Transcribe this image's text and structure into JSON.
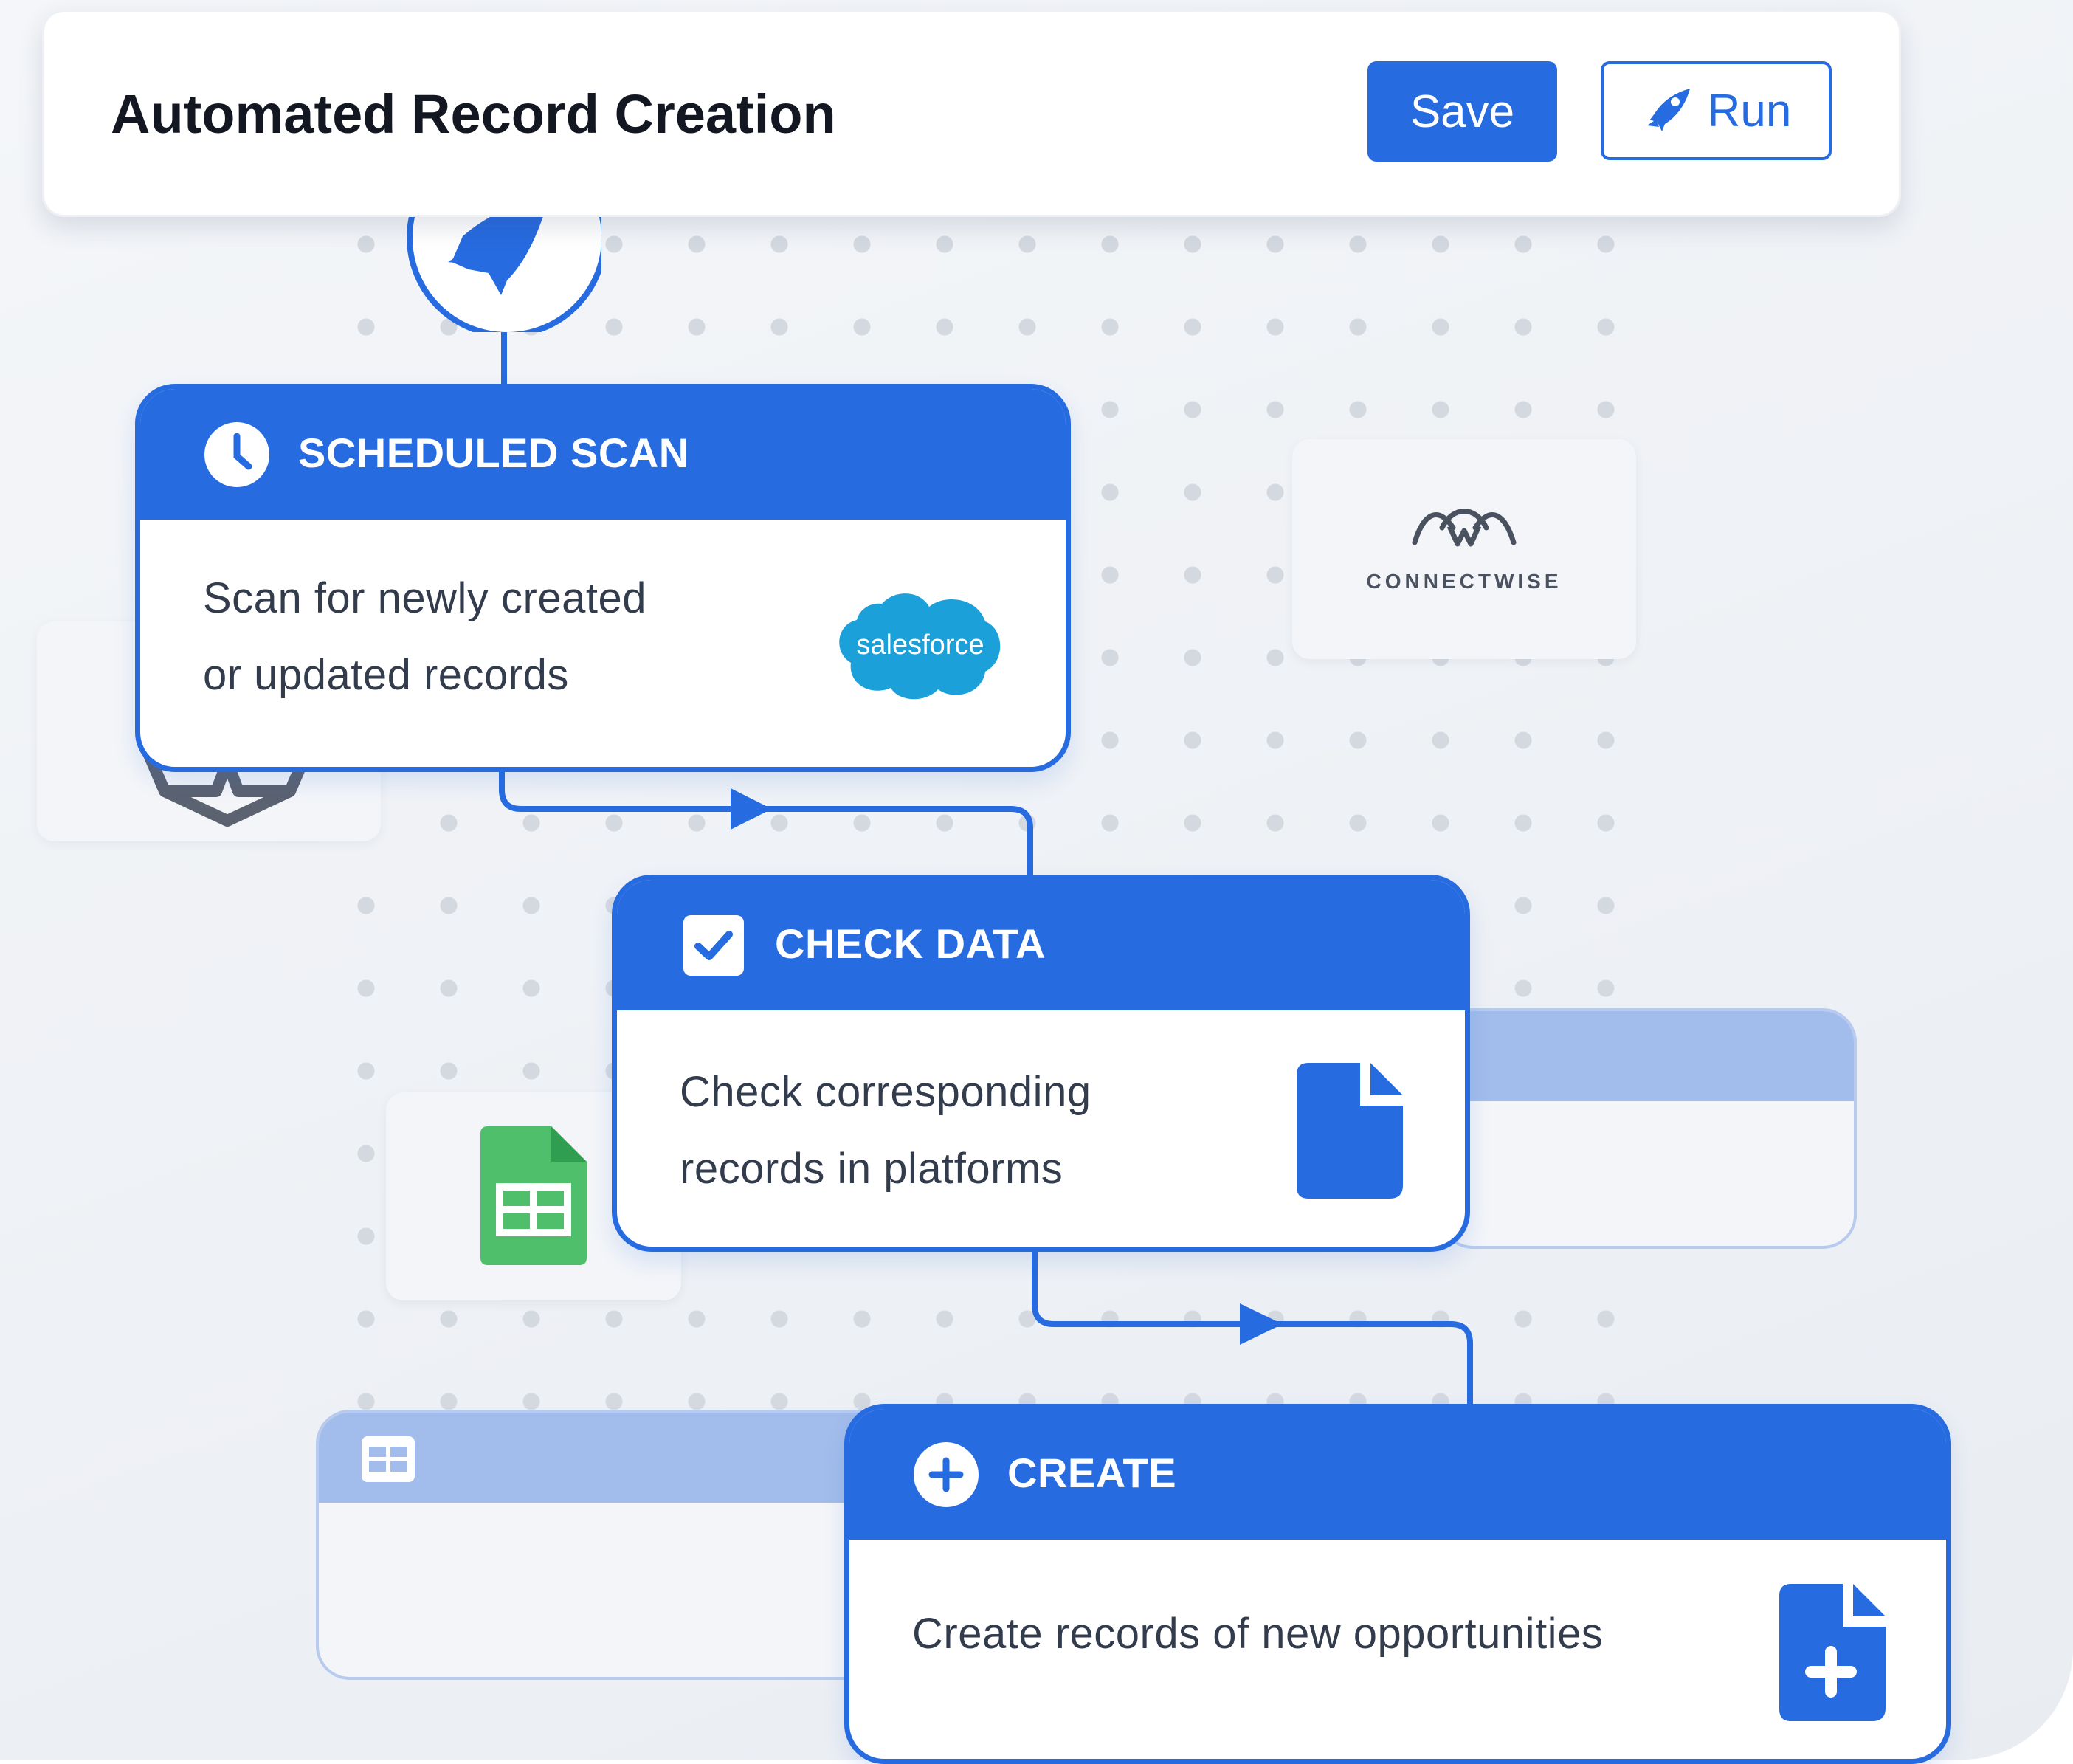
{
  "toolbar": {
    "title": "Automated Record Creation",
    "save_label": "Save",
    "run_label": "Run",
    "run_icon": "rocket-icon"
  },
  "trigger": {
    "icon": "rocket-icon"
  },
  "integrations": {
    "connectwise_label": "CONNECTWISE",
    "connectwise_icon": "connectwise-logo",
    "sheets_icon": "google-sheets-icon",
    "left_icon": "integration-logo"
  },
  "steps": {
    "scan": {
      "title": "SCHEDULED SCAN",
      "icon": "clock-icon",
      "desc_line1": "Scan for newly created",
      "desc_line2": "or updated records",
      "logo_text": "salesforce"
    },
    "check": {
      "title": "CHECK DATA",
      "icon": "checkbox-icon",
      "desc_line1": "Check corresponding",
      "desc_line2": "records in platforms",
      "side_icon": "document-icon"
    },
    "create": {
      "title": "CREATE",
      "icon": "plus-circle-icon",
      "desc_line1": "Create records of new opportunities",
      "side_icon": "document-plus-icon"
    }
  },
  "colors": {
    "accent": "#276be0",
    "ghost_header": "#a2bdeb",
    "sheets_green": "#4fbf6b",
    "salesforce_blue": "#1ba0da"
  }
}
